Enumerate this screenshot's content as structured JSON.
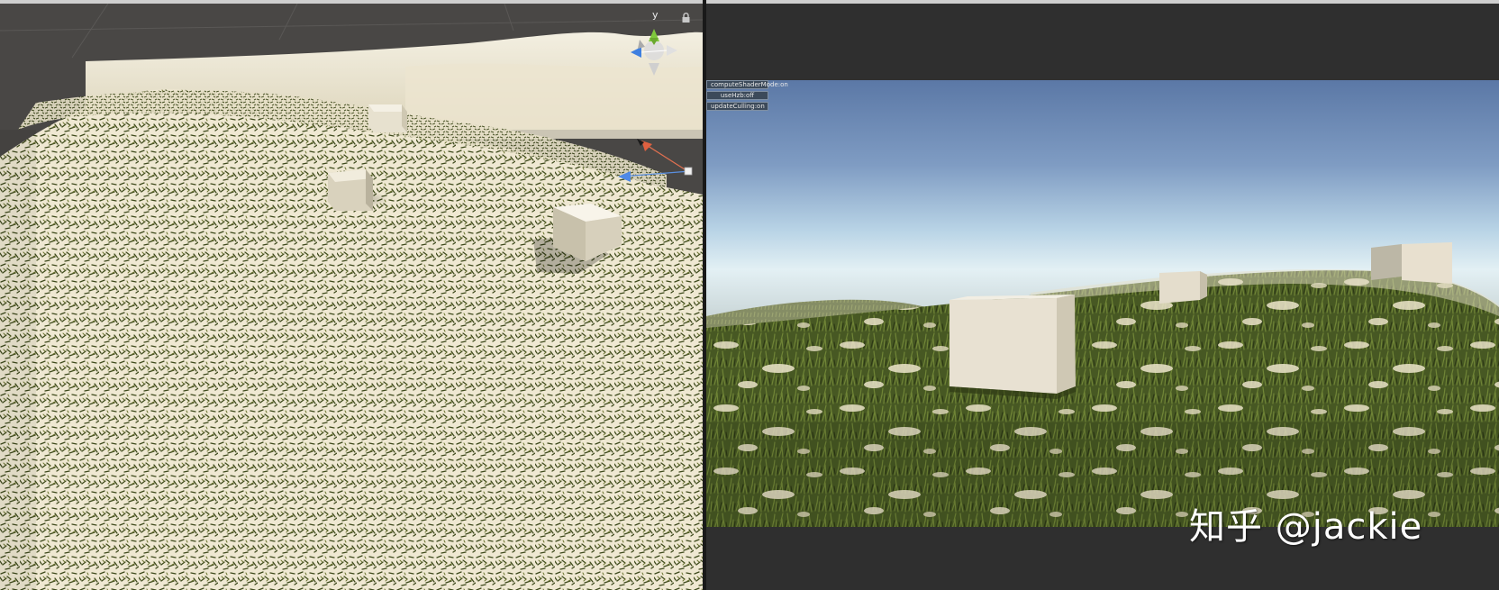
{
  "scene_view": {
    "gizmo_axis_label": "y",
    "gizmo_icon": "scene-orientation-gizmo-icon",
    "lock_icon": "lock-icon"
  },
  "game_view": {
    "debug_buttons": [
      {
        "label": "computeShaderMode:on"
      },
      {
        "label": "useHzb:off"
      },
      {
        "label": "updateCulling:on"
      }
    ]
  },
  "watermark": "知乎 @jackie",
  "colors": {
    "sand": "#efe9d6",
    "grass": "#4a5a26",
    "sky_top": "#5b7aa8",
    "sky_horizon": "#d9eaf2",
    "editor_bg": "#2f2f2f",
    "button_bg": "#3c4a5a"
  }
}
